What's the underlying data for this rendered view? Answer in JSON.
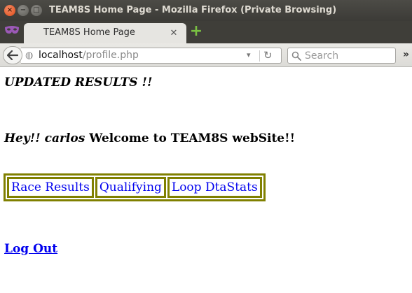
{
  "window": {
    "title": "TEAM8S Home Page - Mozilla Firefox (Private Browsing)",
    "buttons": {
      "close": "×",
      "minimize": "−",
      "maximize": "□"
    }
  },
  "tabs": [
    {
      "label": "TEAM8S Home Page",
      "active": true
    }
  ],
  "new_tab_symbol": "+",
  "navbar": {
    "url_host": "localhost",
    "url_path": "/profile.php",
    "search_placeholder": "Search",
    "overflow_symbol": "»"
  },
  "page": {
    "updated_heading": "UPDATED RESULTS !!",
    "greeting_prefix": "Hey!!",
    "username": "carlos",
    "greeting_suffix": "Welcome to TEAM8S webSite!!",
    "nav_links": [
      "Race Results",
      "Qualifying",
      "Loop DtaStats"
    ],
    "logout_label": "Log Out"
  },
  "colors": {
    "titlebar": "#3c3b37",
    "table_border": "#808000",
    "link": "#0000ee",
    "new_tab": "#7ac142"
  },
  "icons": [
    "private-browsing-mask-icon",
    "back-arrow-icon",
    "globe-icon",
    "reload-icon",
    "search-icon",
    "new-tab-icon"
  ]
}
